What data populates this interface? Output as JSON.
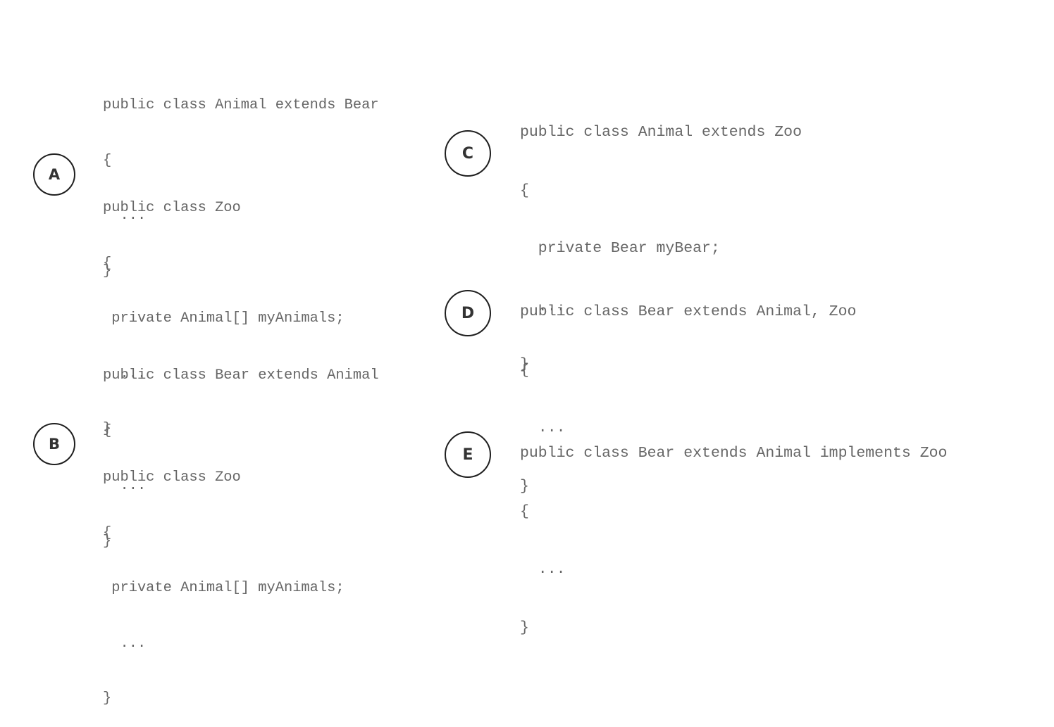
{
  "options": [
    {
      "label": "A",
      "blocks": [
        [
          "public class Animal extends Bear",
          "{",
          "  ...",
          "}"
        ],
        [
          "public class Zoo",
          "{",
          " private Animal[] myAnimals;",
          "  ...",
          "}"
        ]
      ]
    },
    {
      "label": "B",
      "blocks": [
        [
          "public class Bear extends Animal",
          "{",
          "  ...",
          "}"
        ],
        [
          "public class Zoo",
          "{",
          " private Animal[] myAnimals;",
          "  ...",
          "}"
        ]
      ]
    },
    {
      "label": "C",
      "blocks": [
        [
          "public class Animal extends Zoo",
          "{",
          "  private Bear myBear;",
          "  ...",
          "}"
        ]
      ]
    },
    {
      "label": "D",
      "blocks": [
        [
          "public class Bear extends Animal, Zoo",
          "{",
          "  ...",
          "}"
        ]
      ]
    },
    {
      "label": "E",
      "blocks": [
        [
          "public class Bear extends Animal implements Zoo",
          "{",
          "  ...",
          "}"
        ]
      ]
    }
  ]
}
